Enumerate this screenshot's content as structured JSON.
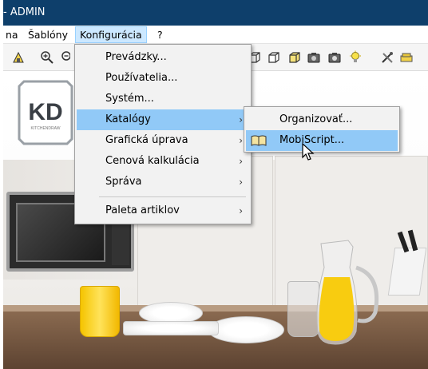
{
  "window": {
    "title": "- ADMIN"
  },
  "menubar": {
    "items": [
      {
        "label": "na"
      },
      {
        "label": "Šablóny"
      },
      {
        "label": "Konfigurácia"
      },
      {
        "label": "?"
      }
    ]
  },
  "toolbar": {
    "icons": [
      "building-icon",
      "zoom-in-icon",
      "zoom-out-icon",
      "box-wire-icon",
      "box-icon",
      "box-open-icon",
      "box-solid-icon",
      "camera-icon",
      "camera-2-icon",
      "light-bulb-icon",
      "tools-icon",
      "sofa-icon"
    ]
  },
  "scene": {
    "logo_text": "KD",
    "logo_subtext": "KITCHENDRAW"
  },
  "konfiguracia_menu": {
    "items": [
      {
        "label": "Prevádzky...",
        "submenu": false
      },
      {
        "label": "Používatelia...",
        "submenu": false
      },
      {
        "label": "Systém...",
        "submenu": false
      },
      {
        "label": "Katalógy",
        "submenu": true,
        "highlighted": true
      },
      {
        "label": "Grafická úprava",
        "submenu": true
      },
      {
        "label": "Cenová kalkulácia",
        "submenu": true
      },
      {
        "label": "Správa",
        "submenu": true
      },
      {
        "label": "Paleta artiklov",
        "submenu": true
      }
    ],
    "arrow": "›"
  },
  "katalogy_menu": {
    "items": [
      {
        "label": "Organizovať...",
        "highlighted": false
      },
      {
        "label": "MobiScript...",
        "highlighted": true,
        "icon": "book-icon"
      }
    ]
  },
  "colors": {
    "titlebar": "#0e3f6b",
    "menu_highlight": "#91c9f7",
    "menubar_active": "#cce8ff"
  }
}
